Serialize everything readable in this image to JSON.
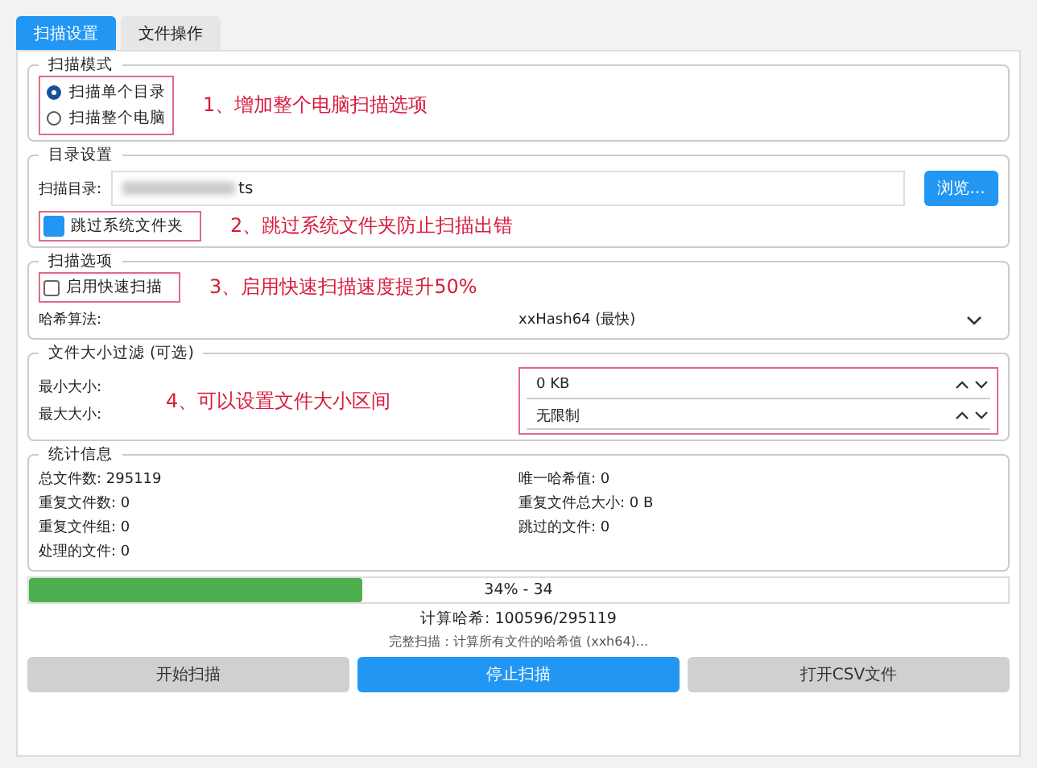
{
  "tabs": [
    {
      "label": "扫描设置",
      "selected": true
    },
    {
      "label": "文件操作",
      "selected": false
    }
  ],
  "scan_mode": {
    "title": "扫描模式",
    "highlighted": true,
    "options": [
      {
        "label": "扫描单个目录",
        "selected": true
      },
      {
        "label": "扫描整个电脑",
        "selected": false
      }
    ],
    "annotation": "1、增加整个电脑扫描选项"
  },
  "directory": {
    "title": "目录设置",
    "label": "扫描目录:",
    "value": "ts",
    "browse": "浏览...",
    "skip_system": {
      "label": "跳过系统文件夹",
      "checked": true,
      "highlighted": true
    },
    "annotation": "2、跳过系统文件夹防止扫描出错"
  },
  "scan_options": {
    "title": "扫描选项",
    "fast_scan": {
      "label": "启用快速扫描",
      "checked": false,
      "highlighted": true
    },
    "annotation": "3、启用快速扫描速度提升50%",
    "hash_label": "哈希算法:",
    "hash_value": "xxHash64 (最快)"
  },
  "size_filter": {
    "title": "文件大小过滤 (可选)",
    "highlighted": true,
    "min_label": "最小大小:",
    "max_label": "最大大小:",
    "min_value": "0 KB",
    "max_value": "无限制",
    "annotation": "4、可以设置文件大小区间"
  },
  "stats": {
    "title": "统计信息",
    "items": [
      "总文件数: 295119",
      "唯一哈希值: 0",
      "重复文件数: 0",
      "重复文件总大小: 0 B",
      "重复文件组: 0",
      "跳过的文件: 0",
      "处理的文件: 0"
    ]
  },
  "progress": {
    "level": 0.34,
    "text": "34% - 34"
  },
  "status": "计算哈希: 100596/295119",
  "detail": "完整扫描：计算所有文件的哈希值 (xxh64)...",
  "buttons": [
    {
      "label": "开始扫描",
      "kind": "primary_off"
    },
    {
      "label": "停止扫描",
      "kind": "primary"
    },
    {
      "label": "打开CSV文件",
      "kind": "primary_off"
    }
  ]
}
